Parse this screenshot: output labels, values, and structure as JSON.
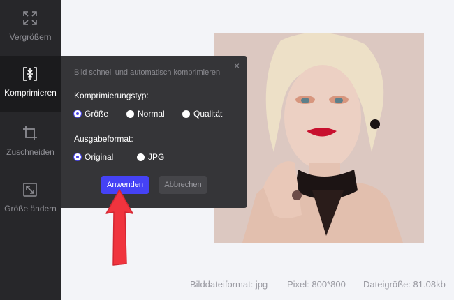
{
  "sidebar": {
    "items": [
      {
        "label": "Vergrößern",
        "icon": "expand-icon"
      },
      {
        "label": "Komprimieren",
        "icon": "compress-icon"
      },
      {
        "label": "Zuschneiden",
        "icon": "crop-icon"
      },
      {
        "label": "Größe ändern",
        "icon": "resize-icon"
      }
    ]
  },
  "dialog": {
    "title": "Bild schnell und automatisch komprimieren",
    "close_glyph": "×",
    "compression_type_label": "Komprimierungstyp:",
    "compression_options": [
      "Größe",
      "Normal",
      "Qualität"
    ],
    "compression_selected": "Größe",
    "output_format_label": "Ausgabeformat:",
    "output_options": [
      "Original",
      "JPG"
    ],
    "output_selected": "Original",
    "apply_label": "Anwenden",
    "cancel_label": "Abbrechen"
  },
  "image_info": {
    "format": "Bilddateiformat: jpg",
    "pixel": "Pixel: 800*800",
    "size": "Dateigröße: 81.08kb"
  },
  "colors": {
    "accent": "#4542f5",
    "sidebar_bg": "#27272a",
    "dialog_bg": "#353538",
    "arrow": "#f0343e"
  }
}
